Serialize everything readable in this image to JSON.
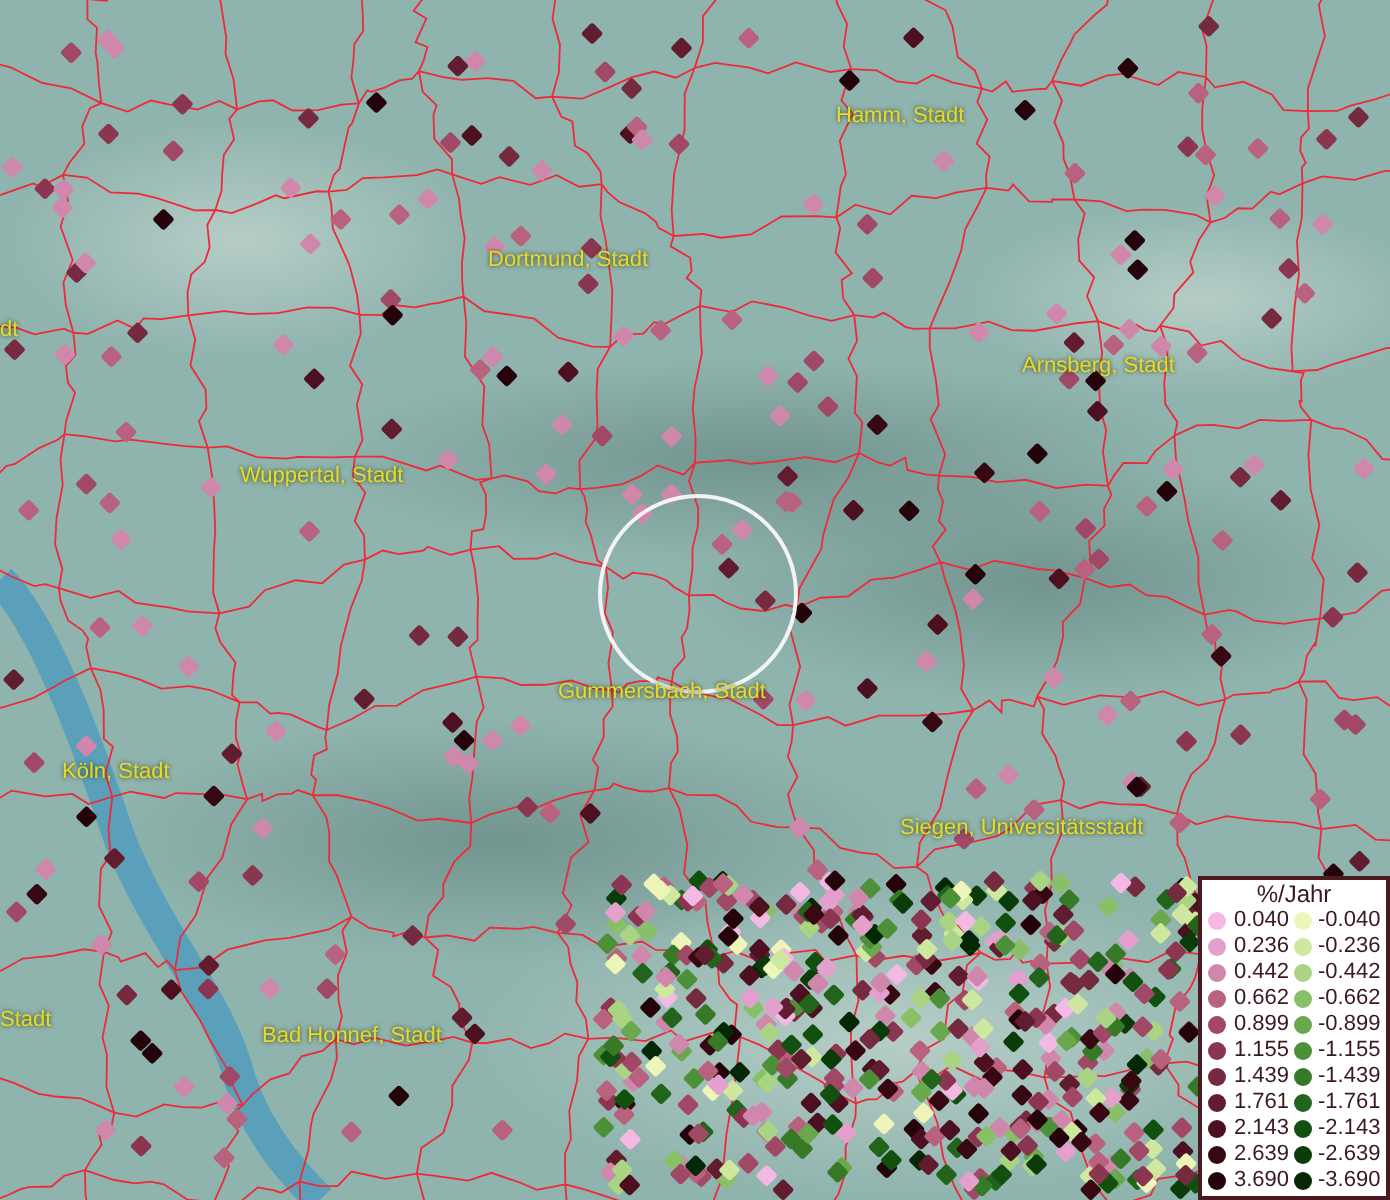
{
  "map": {
    "place_labels": [
      {
        "text": "Hamm, Stadt"
      },
      {
        "text": "Dortmund, Stadt"
      },
      {
        "text": "dt"
      },
      {
        "text": "Arnsberg, Stadt"
      },
      {
        "text": "Wuppertal, Stadt"
      },
      {
        "text": "Gummersbach, Stadt"
      },
      {
        "text": "Köln, Stadt"
      },
      {
        "text": "Siegen, Universitätsstadt"
      },
      {
        "text": "Stadt"
      },
      {
        "text": "Bad Honnef, Stadt"
      }
    ]
  },
  "legend": {
    "title": "%/Jahr",
    "positive": [
      {
        "label": "0.040",
        "color": "#f4b8e4"
      },
      {
        "label": "0.236",
        "color": "#e4a0cc"
      },
      {
        "label": "0.442",
        "color": "#cf88ab"
      },
      {
        "label": "0.662",
        "color": "#b8627f"
      },
      {
        "label": "0.899",
        "color": "#a04866"
      },
      {
        "label": "1.155",
        "color": "#8c3550"
      },
      {
        "label": "1.439",
        "color": "#762a40"
      },
      {
        "label": "1.761",
        "color": "#621c30"
      },
      {
        "label": "2.143",
        "color": "#4c1020"
      },
      {
        "label": "2.639",
        "color": "#380812"
      },
      {
        "label": "3.690",
        "color": "#24040a"
      }
    ],
    "negative": [
      {
        "label": "-0.040",
        "color": "#eef5b8"
      },
      {
        "label": "-0.236",
        "color": "#cfe8a0"
      },
      {
        "label": "-0.442",
        "color": "#a8d484"
      },
      {
        "label": "-0.662",
        "color": "#88c068"
      },
      {
        "label": "-0.899",
        "color": "#6aa84e"
      },
      {
        "label": "-1.155",
        "color": "#4c9038"
      },
      {
        "label": "-1.439",
        "color": "#367a28"
      },
      {
        "label": "-1.761",
        "color": "#22641c"
      },
      {
        "label": "-2.143",
        "color": "#125010"
      },
      {
        "label": "-2.639",
        "color": "#0a3c0a"
      },
      {
        "label": "-3.690",
        "color": "#042806"
      }
    ]
  }
}
